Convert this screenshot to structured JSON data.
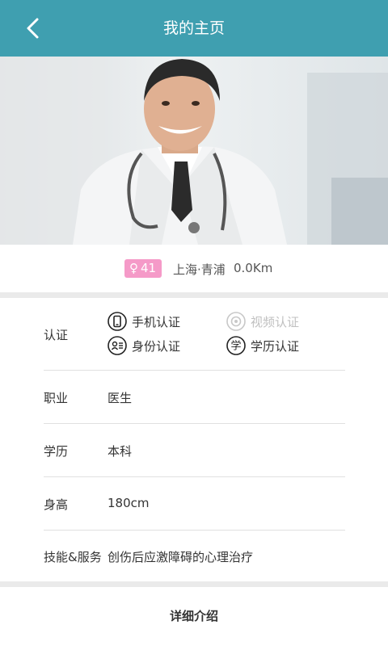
{
  "header": {
    "title": "我的主页",
    "back_icon": "back-arrow-icon"
  },
  "profile": {
    "photo_description": "",
    "gender_symbol": "♀",
    "age": "41",
    "location": "上海·青浦",
    "distance": "0.0Km"
  },
  "details": {
    "certification": {
      "label": "认证",
      "items": [
        {
          "text": "手机认证",
          "icon": "phone-icon",
          "active": true
        },
        {
          "text": "视频认证",
          "icon": "video-icon",
          "active": false
        },
        {
          "text": "身份认证",
          "icon": "id-card-icon",
          "active": true
        },
        {
          "text": "学历认证",
          "icon": "education-icon",
          "active": true
        }
      ]
    },
    "occupation": {
      "label": "职业",
      "value": "医生"
    },
    "education": {
      "label": "学历",
      "value": "本科"
    },
    "height": {
      "label": "身高",
      "value": "180cm"
    },
    "skills": {
      "label": "技能&服务",
      "value": "创伤后应激障碍的心理治疗"
    }
  },
  "section": {
    "detail_intro_title": "详细介绍"
  },
  "colors": {
    "header": "#3f9fb0",
    "badge": "#f59ac8",
    "inactive": "#c8c8c8"
  }
}
